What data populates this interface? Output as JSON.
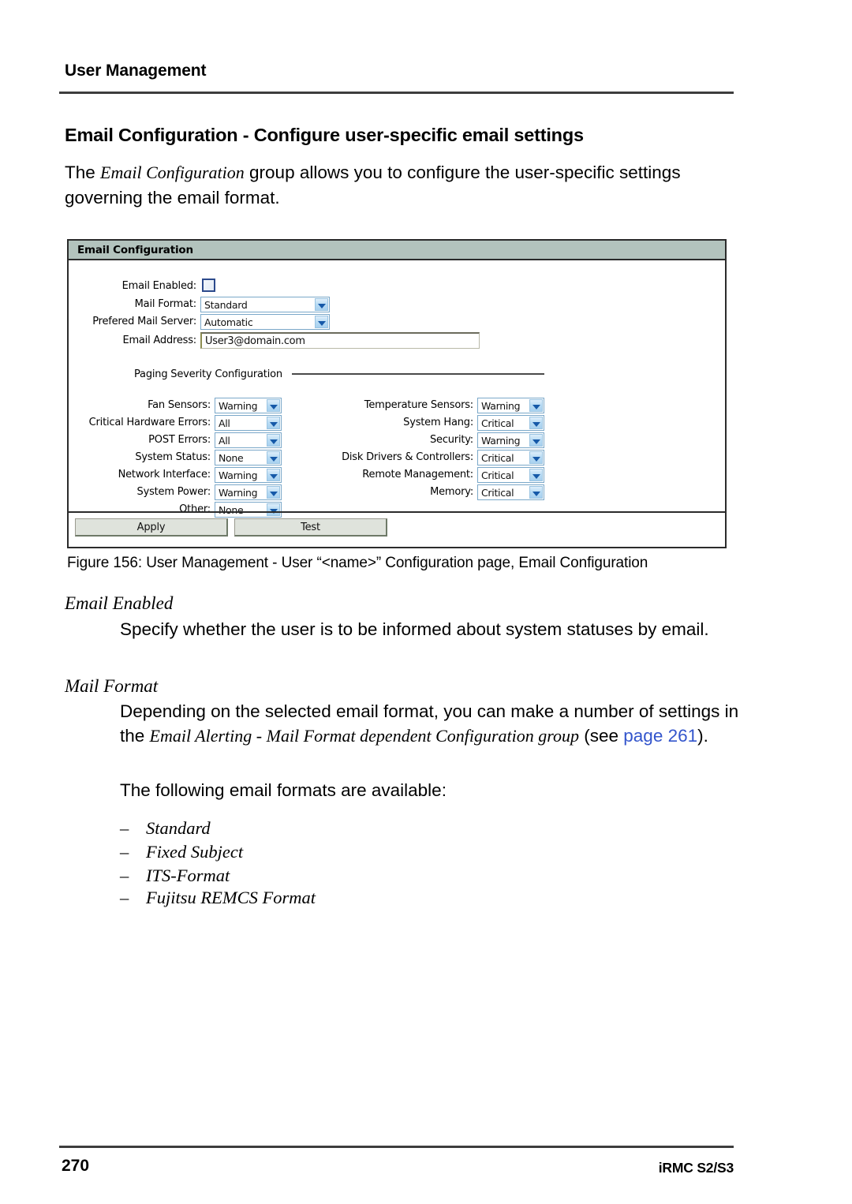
{
  "running_head": "User Management",
  "section_heading": "Email Configuration - Configure user-specific email settings",
  "intro": {
    "before": "The ",
    "italic": "Email Configuration",
    "after": " group allows you to configure the user-specific settings governing the email format."
  },
  "figure": {
    "titlebar": "Email Configuration",
    "form": {
      "email_enabled_label": "Email Enabled:",
      "email_enabled_checked": false,
      "mail_format_label": "Mail Format:",
      "mail_format_value": "Standard",
      "prefered_mail_server_label": "Prefered Mail Server:",
      "prefered_mail_server_value": "Automatic",
      "email_address_label": "Email Address:",
      "email_address_value": "User3@domain.com"
    },
    "paging": {
      "legend": "Paging Severity Configuration",
      "left": [
        {
          "label": "Fan Sensors:",
          "value": "Warning"
        },
        {
          "label": "Critical Hardware Errors:",
          "value": "All"
        },
        {
          "label": "POST Errors:",
          "value": "All"
        },
        {
          "label": "System Status:",
          "value": "None"
        },
        {
          "label": "Network Interface:",
          "value": "Warning"
        },
        {
          "label": "System Power:",
          "value": "Warning"
        },
        {
          "label": "Other:",
          "value": "None"
        }
      ],
      "right": [
        {
          "label": "Temperature Sensors:",
          "value": "Warning"
        },
        {
          "label": "System Hang:",
          "value": "Critical"
        },
        {
          "label": "Security:",
          "value": "Warning"
        },
        {
          "label": "Disk Drivers & Controllers:",
          "value": "Critical"
        },
        {
          "label": "Remote Management:",
          "value": "Critical"
        },
        {
          "label": "Memory:",
          "value": "Critical"
        }
      ]
    },
    "buttons": {
      "apply": "Apply",
      "test": "Test"
    }
  },
  "figure_caption": "Figure 156: User Management - User “<name>” Configuration page, Email Configuration",
  "definitions": [
    {
      "term": "Email Enabled",
      "body": "Specify whether the user is to be informed about system statuses by email."
    },
    {
      "term": "Mail Format",
      "body_1_before": "Depending on the selected email format, you can make a number of settings in the ",
      "body_1_italic": "Email Alerting - Mail Format dependent Configuration group",
      "body_1_mid": " (see ",
      "body_1_link": "page 261",
      "body_1_after": ").",
      "body_2": "The following email formats are available:"
    }
  ],
  "format_list": {
    "dash": "–",
    "items": [
      "Standard",
      "Fixed Subject",
      "ITS-Format",
      "Fujitsu REMCS Format"
    ]
  },
  "footer": {
    "page_number": "270",
    "product": "iRMC S2/S3"
  },
  "colors": {
    "titlebar": "#b3c3bd",
    "link": "#3355cc",
    "rule": "#3d3d3d"
  }
}
